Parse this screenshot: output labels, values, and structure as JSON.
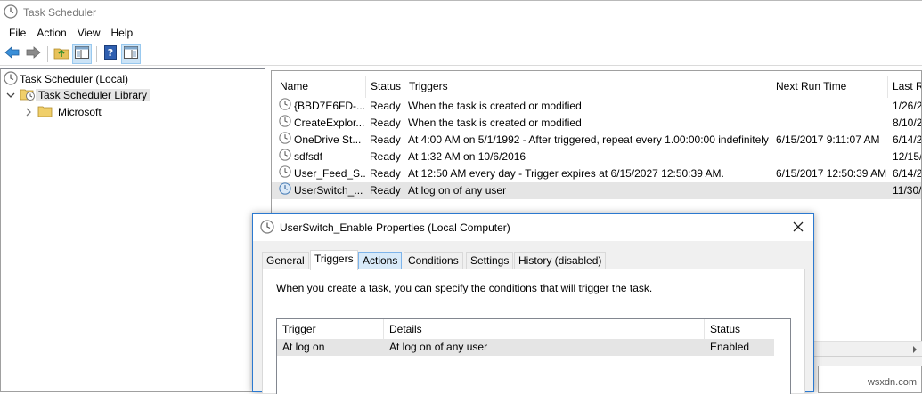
{
  "window": {
    "title": "Task Scheduler",
    "icon": "clock-icon"
  },
  "menu": [
    "File",
    "Action",
    "View",
    "Help"
  ],
  "toolbar": {
    "buttons": [
      "back-arrow-icon",
      "forward-arrow-icon",
      "up-folder-icon",
      "show-hide-console-tree-icon",
      "help-icon",
      "show-hide-action-pane-icon"
    ]
  },
  "tree": {
    "root": "Task Scheduler (Local)",
    "library": "Task Scheduler Library",
    "child": "Microsoft"
  },
  "tasks": {
    "columns": [
      "Name",
      "Status",
      "Triggers",
      "Next Run Time",
      "Last R"
    ],
    "rows": [
      {
        "name": "{BBD7E6FD-...",
        "status": "Ready",
        "triggers": "When the task is created or modified",
        "next": "",
        "last": "1/26/2"
      },
      {
        "name": "CreateExplor...",
        "status": "Ready",
        "triggers": "When the task is created or modified",
        "next": "",
        "last": "8/10/2"
      },
      {
        "name": "OneDrive St...",
        "status": "Ready",
        "triggers": "At 4:00 AM on 5/1/1992 - After triggered, repeat every 1.00:00:00 indefinitely.",
        "next": "6/15/2017 9:11:07 AM",
        "last": "6/14/2"
      },
      {
        "name": "sdfsdf",
        "status": "Ready",
        "triggers": "At 1:32 AM on 10/6/2016",
        "next": "",
        "last": "12/15/"
      },
      {
        "name": "User_Feed_S...",
        "status": "Ready",
        "triggers": "At 12:50 AM every day - Trigger expires at 6/15/2027 12:50:39 AM.",
        "next": "6/15/2017 12:50:39 AM",
        "last": "6/14/2"
      },
      {
        "name": "UserSwitch_...",
        "status": "Ready",
        "triggers": "At log on of any user",
        "next": "",
        "last": "11/30/"
      }
    ]
  },
  "dialog": {
    "title": "UserSwitch_Enable Properties (Local Computer)",
    "tabs": [
      "General",
      "Triggers",
      "Actions",
      "Conditions",
      "Settings",
      "History (disabled)"
    ],
    "active_tab": "Triggers",
    "description": "When you create a task, you can specify the conditions that will trigger the task.",
    "grid": {
      "columns": [
        "Trigger",
        "Details",
        "Status"
      ],
      "row": {
        "trigger": "At log on",
        "details": "At log on of any user",
        "status": "Enabled"
      }
    }
  },
  "watermark": "wsxdn.com",
  "colors": {
    "selection": "#e5e5e5",
    "accent": "#2b79d0",
    "tab_hover": "#d8eaf9"
  }
}
